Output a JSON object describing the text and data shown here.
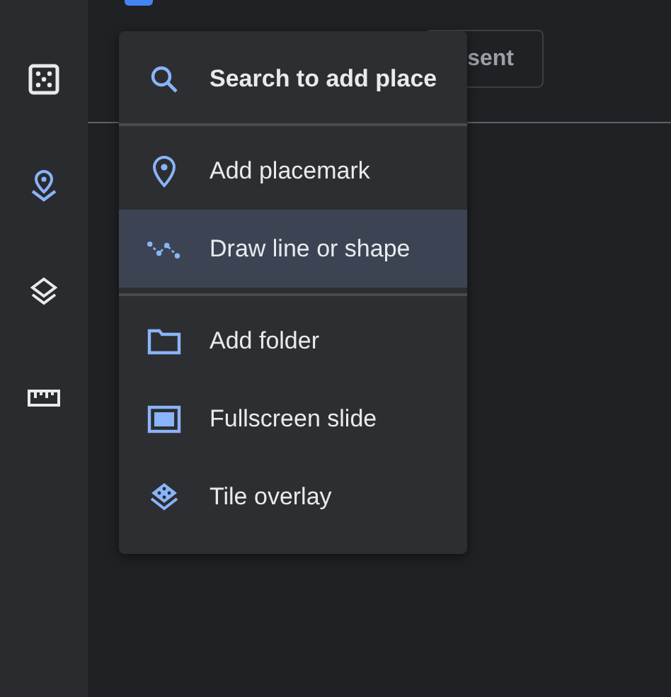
{
  "sidebar": {
    "items": [
      {
        "kind": "dice",
        "selected": false
      },
      {
        "kind": "placemark",
        "selected": true
      },
      {
        "kind": "layers",
        "selected": false
      },
      {
        "kind": "ruler",
        "selected": false
      }
    ]
  },
  "header": {
    "button": "sent"
  },
  "menu": {
    "groups": [
      [
        {
          "kind": "search",
          "label": "Search to add place",
          "selected": false
        }
      ],
      [
        {
          "kind": "placemark",
          "label": "Add placemark",
          "selected": false
        },
        {
          "kind": "line",
          "label": "Draw line or shape",
          "selected": true
        }
      ],
      [
        {
          "kind": "folder",
          "label": "Add folder",
          "selected": false
        },
        {
          "kind": "slide",
          "label": "Fullscreen slide",
          "selected": false
        },
        {
          "kind": "tile",
          "label": "Tile overlay",
          "selected": false
        }
      ]
    ]
  }
}
